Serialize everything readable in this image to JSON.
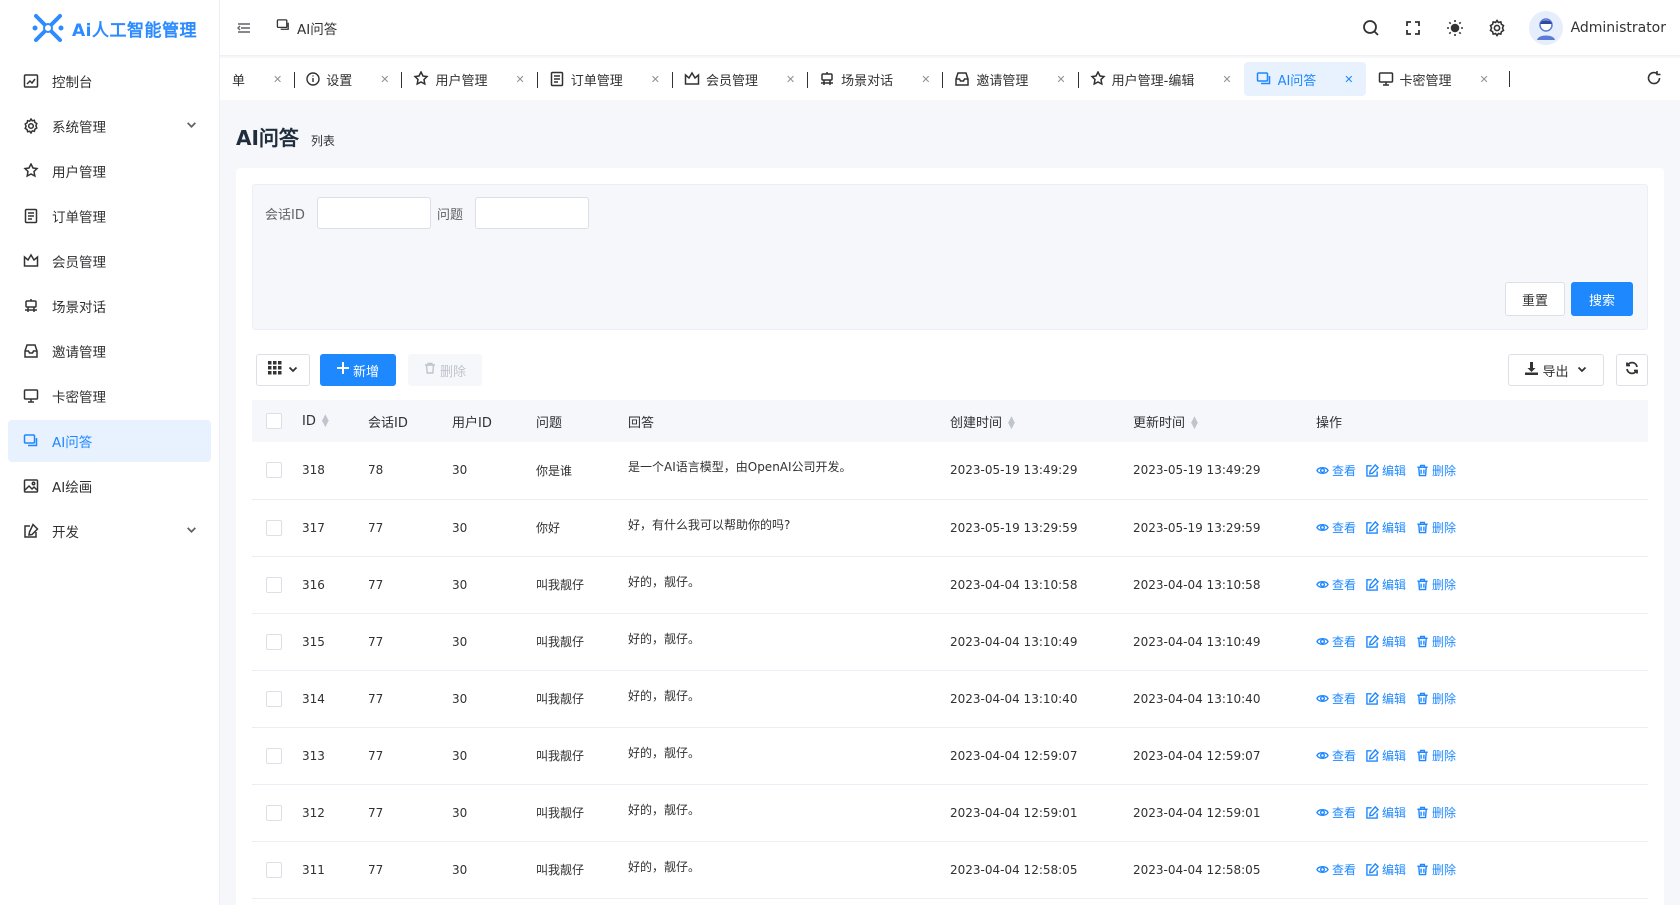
{
  "brand": {
    "title": "Ai人工智能管理",
    "color": "#2b8bff"
  },
  "sidebar": {
    "items": [
      {
        "label": "控制台",
        "icon": "dashboard-icon",
        "name": "sidebar-item-dashboard"
      },
      {
        "label": "系统管理",
        "icon": "gear-icon",
        "name": "sidebar-item-system",
        "expandable": true
      },
      {
        "label": "用户管理",
        "icon": "user-icon",
        "name": "sidebar-item-users"
      },
      {
        "label": "订单管理",
        "icon": "order-icon",
        "name": "sidebar-item-orders"
      },
      {
        "label": "会员管理",
        "icon": "crown-icon",
        "name": "sidebar-item-members"
      },
      {
        "label": "场景对话",
        "icon": "chat-scene-icon",
        "name": "sidebar-item-scenes"
      },
      {
        "label": "邀请管理",
        "icon": "inbox-icon",
        "name": "sidebar-item-invites"
      },
      {
        "label": "卡密管理",
        "icon": "monitor-icon",
        "name": "sidebar-item-cards"
      },
      {
        "label": "AI问答",
        "icon": "chat-icon",
        "name": "sidebar-item-ai-qa",
        "active": true
      },
      {
        "label": "AI绘画",
        "icon": "image-icon",
        "name": "sidebar-item-ai-draw"
      },
      {
        "label": "开发",
        "icon": "dev-icon",
        "name": "sidebar-item-dev",
        "expandable": true
      }
    ]
  },
  "header": {
    "breadcrumb": "AI问答",
    "user_name": "Administrator",
    "accent": "#1e88ff"
  },
  "tabs": [
    {
      "label": "单",
      "icon": ""
    },
    {
      "label": "设置",
      "icon": "info-icon"
    },
    {
      "label": "用户管理",
      "icon": "user-icon"
    },
    {
      "label": "订单管理",
      "icon": "order-icon"
    },
    {
      "label": "会员管理",
      "icon": "crown-icon"
    },
    {
      "label": "场景对话",
      "icon": "chat-scene-icon"
    },
    {
      "label": "邀请管理",
      "icon": "inbox-icon"
    },
    {
      "label": "用户管理-编辑",
      "icon": "user-icon"
    },
    {
      "label": "AI问答",
      "icon": "chat-icon",
      "active": true
    },
    {
      "label": "卡密管理",
      "icon": "monitor-icon"
    }
  ],
  "page": {
    "title": "AI问答",
    "subtitle": "列表"
  },
  "search": {
    "session_label": "会话ID",
    "session_value": "",
    "question_label": "问题",
    "question_value": "",
    "reset_label": "重置",
    "search_label": "搜索"
  },
  "toolbar": {
    "add_label": "新增",
    "delete_label": "删除",
    "export_label": "导出"
  },
  "table": {
    "columns": [
      "ID",
      "会话ID",
      "用户ID",
      "问题",
      "回答",
      "创建时间",
      "更新时间",
      "操作"
    ],
    "rows": [
      {
        "id": "318",
        "session": "78",
        "user": "30",
        "question": "你是谁",
        "answer": "是一个AI语言模型，由OpenAI公司开发。",
        "created": "2023-05-19 13:49:29",
        "updated": "2023-05-19 13:49:29"
      },
      {
        "id": "317",
        "session": "77",
        "user": "30",
        "question": "你好",
        "answer": "好，有什么我可以帮助你的吗?",
        "created": "2023-05-19 13:29:59",
        "updated": "2023-05-19 13:29:59"
      },
      {
        "id": "316",
        "session": "77",
        "user": "30",
        "question": "叫我靓仔",
        "answer": "好的，靓仔。",
        "created": "2023-04-04 13:10:58",
        "updated": "2023-04-04 13:10:58"
      },
      {
        "id": "315",
        "session": "77",
        "user": "30",
        "question": "叫我靓仔",
        "answer": "好的，靓仔。",
        "created": "2023-04-04 13:10:49",
        "updated": "2023-04-04 13:10:49"
      },
      {
        "id": "314",
        "session": "77",
        "user": "30",
        "question": "叫我靓仔",
        "answer": "好的，靓仔。",
        "created": "2023-04-04 13:10:40",
        "updated": "2023-04-04 13:10:40"
      },
      {
        "id": "313",
        "session": "77",
        "user": "30",
        "question": "叫我靓仔",
        "answer": "好的，靓仔。",
        "created": "2023-04-04 12:59:07",
        "updated": "2023-04-04 12:59:07"
      },
      {
        "id": "312",
        "session": "77",
        "user": "30",
        "question": "叫我靓仔",
        "answer": "好的，靓仔。",
        "created": "2023-04-04 12:59:01",
        "updated": "2023-04-04 12:59:01"
      },
      {
        "id": "311",
        "session": "77",
        "user": "30",
        "question": "叫我靓仔",
        "answer": "好的，靓仔。",
        "created": "2023-04-04 12:58:05",
        "updated": "2023-04-04 12:58:05"
      }
    ],
    "actions": {
      "view": "查看",
      "edit": "编辑",
      "delete": "删除"
    }
  }
}
